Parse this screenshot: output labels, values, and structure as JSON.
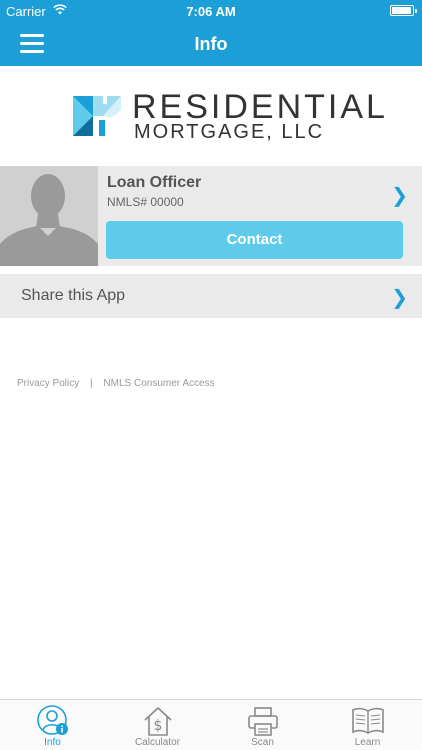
{
  "status_bar": {
    "carrier": "Carrier",
    "time": "7:06 AM"
  },
  "nav": {
    "title": "Info",
    "menu_icon": "hamburger-icon"
  },
  "logo": {
    "line1": "RESIDENTIAL",
    "line2": "MORTGAGE, LLC"
  },
  "officer": {
    "name": "Loan Officer",
    "nmls": "NMLS# 00000",
    "chevron": "❯",
    "contact_label": "Contact"
  },
  "share": {
    "label": "Share this App",
    "chevron": "❯"
  },
  "links": {
    "privacy": "Privacy Policy",
    "separator": "|",
    "nmls_access": "NMLS Consumer Access"
  },
  "tabs": [
    {
      "label": "Info",
      "icon": "info-person-icon",
      "active": true
    },
    {
      "label": "Calculator",
      "icon": "calculator-house-icon",
      "active": false
    },
    {
      "label": "Scan",
      "icon": "printer-icon",
      "active": false
    },
    {
      "label": "Learn",
      "icon": "book-icon",
      "active": false
    }
  ],
  "colors": {
    "brand": "#1b9fd6",
    "contact": "#5ecbea",
    "panel": "#eaeaea"
  }
}
